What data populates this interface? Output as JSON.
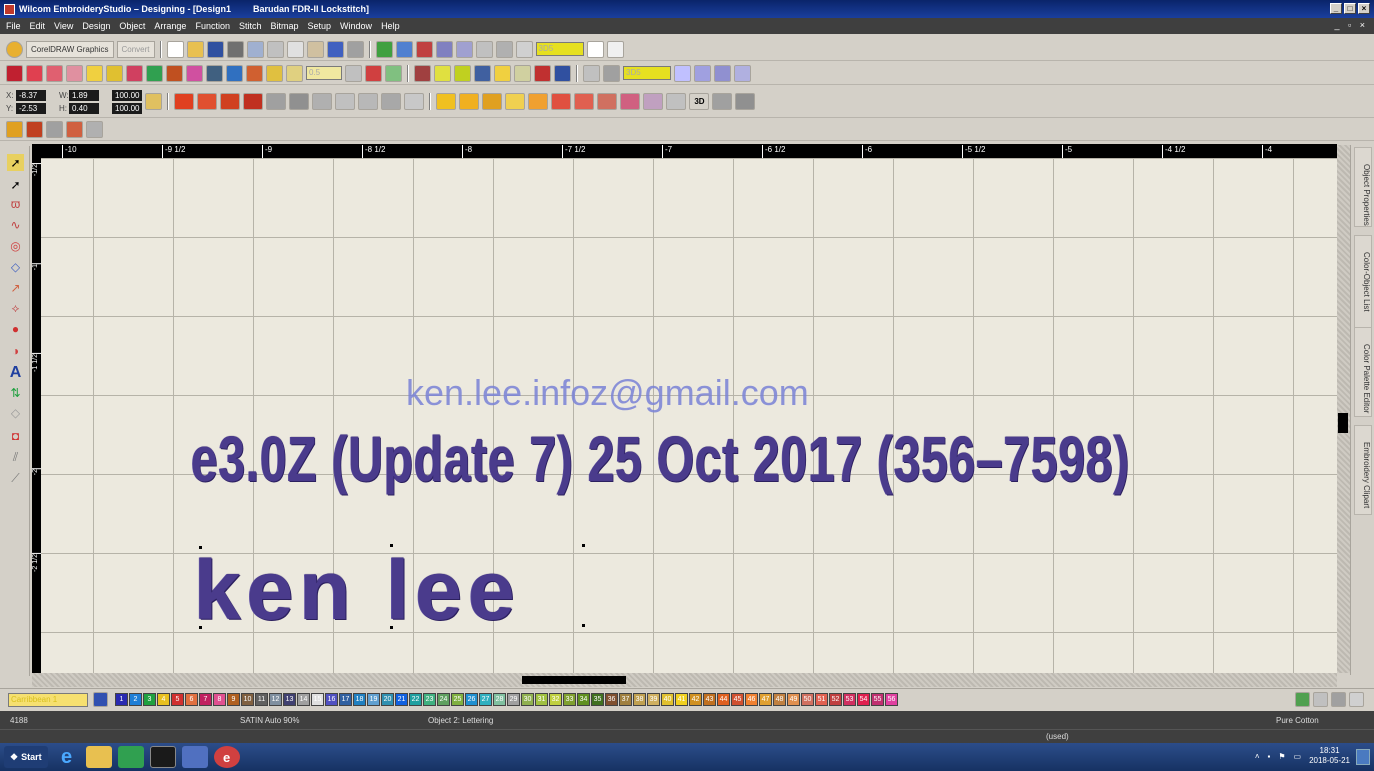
{
  "window": {
    "title": "Wilcom EmbroideryStudio – Designing - [Design1",
    "machine": "Barudan FDR-II Lockstitch]"
  },
  "menu": [
    "File",
    "Edit",
    "View",
    "Design",
    "Object",
    "Arrange",
    "Function",
    "Stitch",
    "Bitmap",
    "Setup",
    "Window",
    "Help"
  ],
  "toolbar": {
    "corel_label": "CorelDRAW Graphics",
    "convert_label": "Convert",
    "zoom_combo": "3D5",
    "zoom_combo2": "3D5",
    "stitch_combo": "0.5"
  },
  "properties": {
    "x_label": "X:",
    "x_value": "-8.37",
    "y_label": "Y:",
    "y_value": "-2.53",
    "w_label": "W:",
    "w_value": "1.89",
    "h_label": "H:",
    "h_value": "0.40",
    "sx_value": "100.00",
    "sy_value": "100.00",
    "three_d": "3D"
  },
  "ruler": {
    "top": [
      "-10",
      "-9 1/2",
      "-9",
      "-8 1/2",
      "-8",
      "-7 1/2",
      "-7",
      "-6 1/2",
      "-6",
      "-5 1/2",
      "-5",
      "-4 1/2",
      "-4"
    ],
    "left": [
      "-1/2",
      "-1",
      "-1 1/2",
      "-2",
      "-2 1/2"
    ]
  },
  "canvas": {
    "line1": "e3.0Z (Update 7) 25 Oct 2017 (356–7598)",
    "line2": "ken lee",
    "watermark": "ken.lee.infoz@gmail.com"
  },
  "dockers": [
    "Object Properties",
    "Color-Object List",
    "Color Palette Editor",
    "Embroidery Clipart"
  ],
  "palette": {
    "combo": "Carribbean 1",
    "swatches": [
      {
        "n": "1",
        "c": "#2a2ab0"
      },
      {
        "n": "2",
        "c": "#1f7fd6"
      },
      {
        "n": "3",
        "c": "#20a040"
      },
      {
        "n": "4",
        "c": "#e8c020"
      },
      {
        "n": "5",
        "c": "#d03030"
      },
      {
        "n": "6",
        "c": "#e07040"
      },
      {
        "n": "7",
        "c": "#c02060"
      },
      {
        "n": "8",
        "c": "#e05090"
      },
      {
        "n": "9",
        "c": "#b06020"
      },
      {
        "n": "10",
        "c": "#806040"
      },
      {
        "n": "11",
        "c": "#606060"
      },
      {
        "n": "12",
        "c": "#8090a0"
      },
      {
        "n": "13",
        "c": "#404070"
      },
      {
        "n": "14",
        "c": "#a0a0a0"
      },
      {
        "n": "15",
        "c": "#e0e0e0"
      },
      {
        "n": "16",
        "c": "#5050c0"
      },
      {
        "n": "17",
        "c": "#3060a0"
      },
      {
        "n": "18",
        "c": "#2080c0"
      },
      {
        "n": "19",
        "c": "#60a0d0"
      },
      {
        "n": "20",
        "c": "#3090b0"
      },
      {
        "n": "21",
        "c": "#1060e0"
      },
      {
        "n": "22",
        "c": "#20a0a0"
      },
      {
        "n": "23",
        "c": "#40b080"
      },
      {
        "n": "24",
        "c": "#60a060"
      },
      {
        "n": "25",
        "c": "#80b040"
      },
      {
        "n": "26",
        "c": "#2090d0"
      },
      {
        "n": "27",
        "c": "#30b0c0"
      },
      {
        "n": "28",
        "c": "#80c0a0"
      },
      {
        "n": "29",
        "c": "#a0a0a0"
      },
      {
        "n": "30",
        "c": "#90b050"
      },
      {
        "n": "31",
        "c": "#a0c040"
      },
      {
        "n": "32",
        "c": "#c0d040"
      },
      {
        "n": "33",
        "c": "#80a030"
      },
      {
        "n": "34",
        "c": "#609020"
      },
      {
        "n": "35",
        "c": "#407020"
      },
      {
        "n": "36",
        "c": "#805030"
      },
      {
        "n": "37",
        "c": "#a08040"
      },
      {
        "n": "38",
        "c": "#c0a050"
      },
      {
        "n": "39",
        "c": "#d0b060"
      },
      {
        "n": "40",
        "c": "#e0c030"
      },
      {
        "n": "41",
        "c": "#f0d020"
      },
      {
        "n": "42",
        "c": "#d09020"
      },
      {
        "n": "43",
        "c": "#c07020"
      },
      {
        "n": "44",
        "c": "#e06020"
      },
      {
        "n": "45",
        "c": "#d05030"
      },
      {
        "n": "46",
        "c": "#f08030"
      },
      {
        "n": "47",
        "c": "#e0a030"
      },
      {
        "n": "48",
        "c": "#c08040"
      },
      {
        "n": "49",
        "c": "#e09050"
      },
      {
        "n": "50",
        "c": "#d07060"
      },
      {
        "n": "51",
        "c": "#e06050"
      },
      {
        "n": "52",
        "c": "#c04040"
      },
      {
        "n": "53",
        "c": "#d03060"
      },
      {
        "n": "54",
        "c": "#e02050"
      },
      {
        "n": "55",
        "c": "#c03070"
      },
      {
        "n": "56",
        "c": "#e040a0"
      }
    ]
  },
  "status": {
    "stitches": "4188",
    "stitch_type": "SATIN Auto 90%",
    "object": "Object 2: Lettering",
    "fabric": "Pure Cotton",
    "used": "(used)"
  },
  "taskbar": {
    "start": "Start",
    "time": "18:31",
    "date": "2018-05-21"
  }
}
